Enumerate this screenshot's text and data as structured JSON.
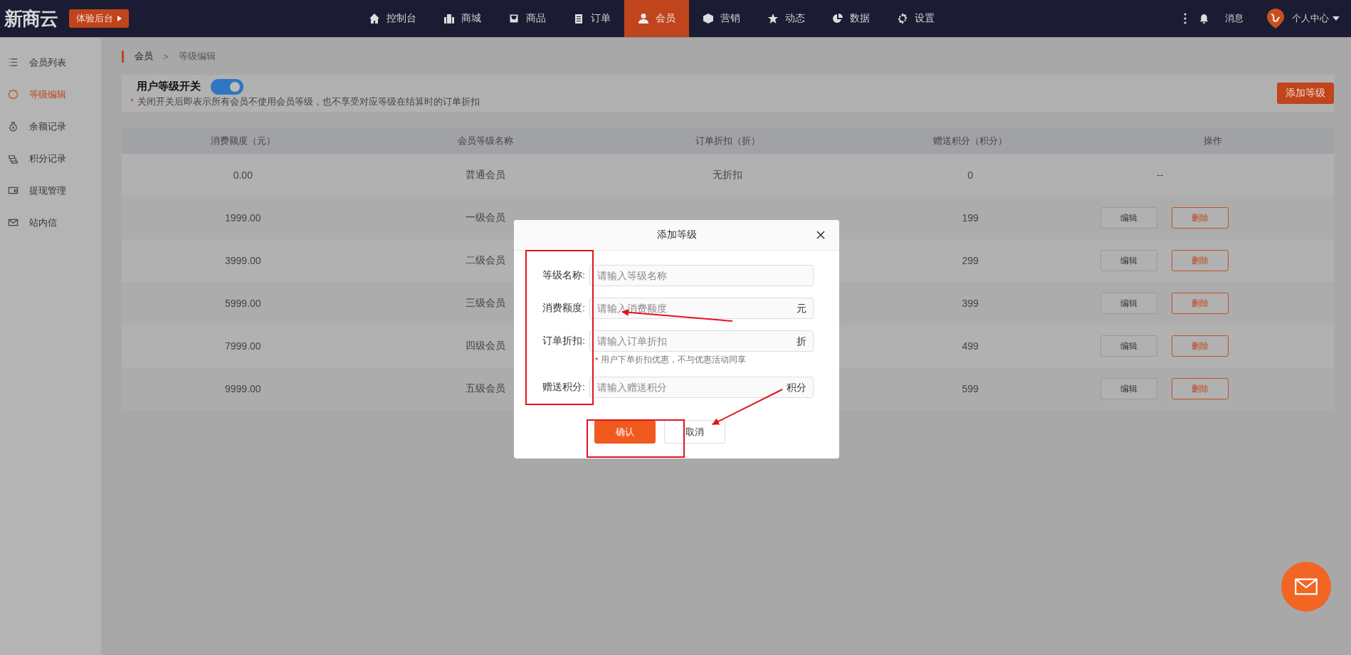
{
  "top_bar": {
    "logo": "新商云",
    "trial_badge": "体验后台",
    "nav": [
      {
        "label": "控制台",
        "selected": false
      },
      {
        "label": "商城",
        "selected": false
      },
      {
        "label": "商品",
        "selected": false
      },
      {
        "label": "订单",
        "selected": false
      },
      {
        "label": "会员",
        "selected": true
      },
      {
        "label": "营销",
        "selected": false
      },
      {
        "label": "动态",
        "selected": false
      },
      {
        "label": "数据",
        "selected": false
      },
      {
        "label": "设置",
        "selected": false
      }
    ],
    "messages": "消息",
    "user_menu": "个人中心"
  },
  "sidebar": {
    "items": [
      {
        "label": "会员列表",
        "selected": false
      },
      {
        "label": "等级编辑",
        "selected": true
      },
      {
        "label": "余额记录",
        "selected": false
      },
      {
        "label": "积分记录",
        "selected": false
      },
      {
        "label": "提现管理",
        "selected": false
      },
      {
        "label": "站内信",
        "selected": false
      }
    ]
  },
  "breadcrumb": {
    "items": [
      "会员",
      "等级编辑"
    ],
    "separator": ">"
  },
  "level_switch": {
    "label": "用户等级开关",
    "on": true,
    "note_mark": "*",
    "note": "关闭开关后即表示所有会员不使用会员等级，也不享受对应等级在结算时的订单折扣"
  },
  "add_button": "添加等级",
  "table": {
    "columns": [
      "消费额度（元）",
      "会员等级名称",
      "订单折扣（折）",
      "赠送积分（积分）",
      "操作"
    ],
    "rows": [
      {
        "amount": "0.00",
        "name": "普通会员",
        "discount": "无折扣",
        "points": "0",
        "no_actions": "--"
      },
      {
        "amount": "1999.00",
        "name": "一级会员",
        "points": "199",
        "actions": [
          {
            "label": "编辑",
            "kind": "edit"
          },
          {
            "label": "删除",
            "kind": "delete"
          }
        ]
      },
      {
        "amount": "3999.00",
        "name": "二级会员",
        "points": "299",
        "actions": [
          {
            "label": "编辑",
            "kind": "edit"
          },
          {
            "label": "删除",
            "kind": "delete"
          }
        ]
      },
      {
        "amount": "5999.00",
        "name": "三级会员",
        "points": "399",
        "actions": [
          {
            "label": "编辑",
            "kind": "edit"
          },
          {
            "label": "删除",
            "kind": "delete"
          }
        ]
      },
      {
        "amount": "7999.00",
        "name": "四级会员",
        "points": "499",
        "actions": [
          {
            "label": "编辑",
            "kind": "edit"
          },
          {
            "label": "删除",
            "kind": "delete"
          }
        ]
      },
      {
        "amount": "9999.00",
        "name": "五级会员",
        "points": "599",
        "actions": [
          {
            "label": "编辑",
            "kind": "edit"
          },
          {
            "label": "删除",
            "kind": "delete"
          }
        ]
      }
    ]
  },
  "dialog": {
    "title": "添加等级",
    "fields": [
      {
        "label": "等级名称:",
        "placeholder": "请输入等级名称"
      },
      {
        "label": "消费额度:",
        "placeholder": "请输入消费额度",
        "suffix": "元"
      },
      {
        "label": "订单折扣:",
        "placeholder": "请输入订单折扣",
        "suffix": "折",
        "hint_mark": "*",
        "hint": "用户下单折扣优惠，不与优惠活动同享"
      },
      {
        "label": "赠送积分:",
        "placeholder": "请输入赠送积分",
        "suffix": "积分"
      }
    ],
    "buttons": [
      {
        "label": "确认",
        "kind": "primary"
      },
      {
        "label": "取消",
        "kind": "default"
      }
    ]
  }
}
